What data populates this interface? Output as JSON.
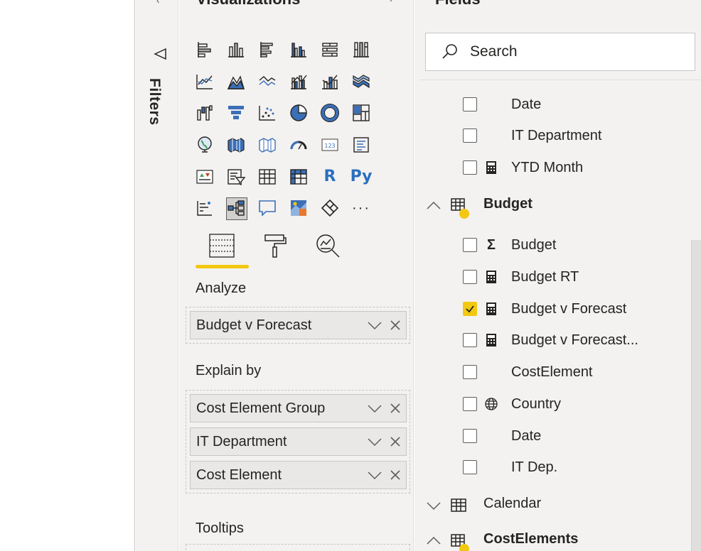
{
  "filters": {
    "label": "Filters"
  },
  "visualizations": {
    "title": "Visualizations",
    "icons": [
      "stacked-bar-icon",
      "stacked-column-icon",
      "clustered-bar-icon",
      "clustered-column-icon",
      "100-stacked-bar-icon",
      "100-stacked-column-icon",
      "line-chart-icon",
      "area-chart-icon",
      "stacked-area-icon",
      "line-clustered-column-icon",
      "line-stacked-column-icon",
      "ribbon-chart-icon",
      "waterfall-chart-icon",
      "funnel-chart-icon",
      "scatter-chart-icon",
      "pie-chart-icon",
      "donut-chart-icon",
      "treemap-icon",
      "map-icon",
      "filled-map-icon",
      "shape-map-icon",
      "gauge-icon",
      "card-icon",
      "multi-row-card-icon",
      "kpi-icon",
      "slicer-icon",
      "table-icon",
      "matrix-icon",
      "r-visual-icon",
      "python-visual-icon",
      "key-influencers-icon",
      "decomposition-tree-icon",
      "qa-icon",
      "arcgis-map-icon",
      "power-apps-icon",
      "more-visuals-icon"
    ],
    "r_label": "R",
    "py_label": "Py",
    "more_label": "···",
    "analyze_label": "Analyze",
    "analyze_field": "Budget v Forecast",
    "explain_label": "Explain by",
    "explain_fields": [
      "Cost Element Group",
      "IT Department",
      "Cost Element"
    ],
    "tooltips_label": "Tooltips"
  },
  "fields": {
    "title": "Fields",
    "search_placeholder": "Search",
    "top_items": [
      {
        "name": "Date",
        "type": ""
      },
      {
        "name": "IT Department",
        "type": ""
      },
      {
        "name": "YTD Month",
        "type": "calc"
      }
    ],
    "budget_table": "Budget",
    "budget_items": [
      {
        "name": "Budget",
        "type": "sigma",
        "checked": false
      },
      {
        "name": "Budget RT",
        "type": "calc",
        "checked": false
      },
      {
        "name": "Budget v Forecast",
        "type": "calc",
        "checked": true
      },
      {
        "name": "Budget v Forecast...",
        "type": "calc",
        "checked": false
      },
      {
        "name": "CostElement",
        "type": "",
        "checked": false
      },
      {
        "name": "Country",
        "type": "globe",
        "checked": false
      },
      {
        "name": "Date",
        "type": "",
        "checked": false
      },
      {
        "name": "IT Dep.",
        "type": "",
        "checked": false
      }
    ],
    "calendar_table": "Calendar",
    "costelements_table": "CostElements"
  },
  "colors": {
    "accent": "#f2c811",
    "pane": "#f3f2f1",
    "text": "#252423",
    "blue": "#2b6fbd"
  }
}
